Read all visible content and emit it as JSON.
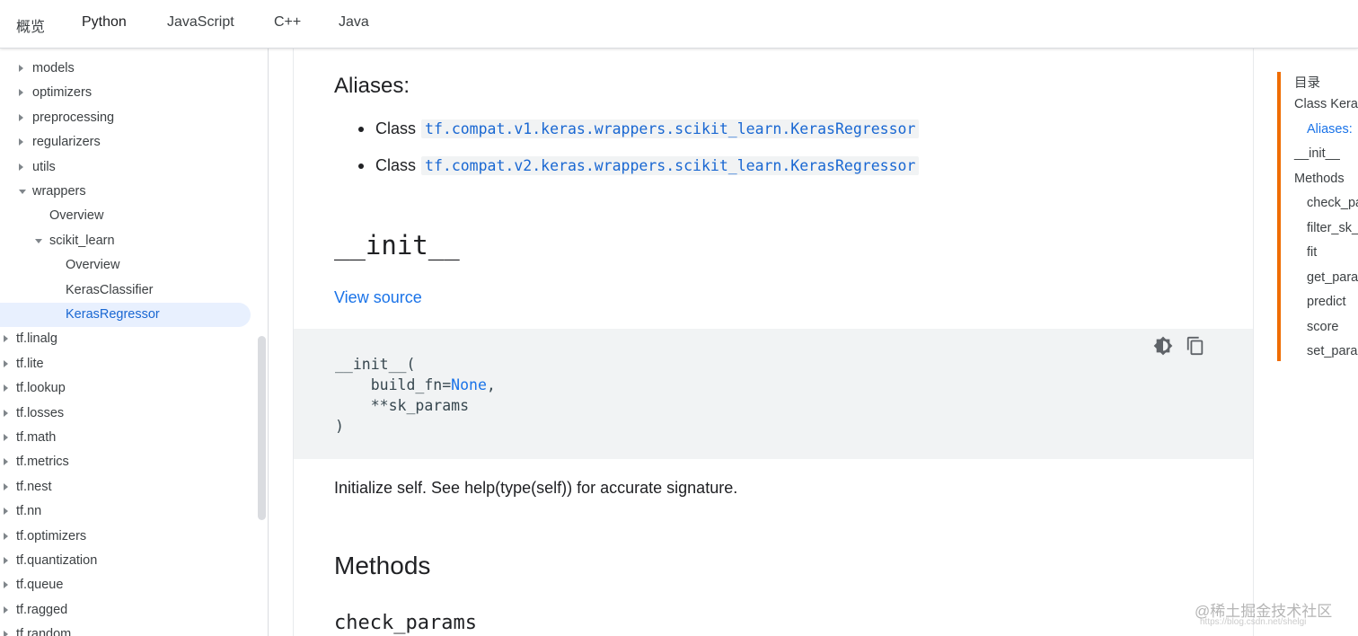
{
  "tabs": [
    "概览",
    "Python",
    "JavaScript",
    "C++",
    "Java"
  ],
  "active_tab": "Python",
  "sidebar": {
    "items": [
      {
        "label": "models",
        "level": 1,
        "caret": "right"
      },
      {
        "label": "optimizers",
        "level": 1,
        "caret": "right"
      },
      {
        "label": "preprocessing",
        "level": 1,
        "caret": "right"
      },
      {
        "label": "regularizers",
        "level": 1,
        "caret": "right"
      },
      {
        "label": "utils",
        "level": 1,
        "caret": "right"
      },
      {
        "label": "wrappers",
        "level": 1,
        "caret": "down"
      },
      {
        "label": "Overview",
        "level": 2,
        "caret": "none"
      },
      {
        "label": "scikit_learn",
        "level": 2,
        "caret": "down"
      },
      {
        "label": "Overview",
        "level": 3,
        "caret": "none"
      },
      {
        "label": "KerasClassifier",
        "level": 3,
        "caret": "none"
      },
      {
        "label": "KerasRegressor",
        "level": 3,
        "caret": "none",
        "selected": true
      },
      {
        "label": "tf.linalg",
        "level": 0,
        "caret": "right"
      },
      {
        "label": "tf.lite",
        "level": 0,
        "caret": "right"
      },
      {
        "label": "tf.lookup",
        "level": 0,
        "caret": "right"
      },
      {
        "label": "tf.losses",
        "level": 0,
        "caret": "right"
      },
      {
        "label": "tf.math",
        "level": 0,
        "caret": "right"
      },
      {
        "label": "tf.metrics",
        "level": 0,
        "caret": "right"
      },
      {
        "label": "tf.nest",
        "level": 0,
        "caret": "right"
      },
      {
        "label": "tf.nn",
        "level": 0,
        "caret": "right"
      },
      {
        "label": "tf.optimizers",
        "level": 0,
        "caret": "right"
      },
      {
        "label": "tf.quantization",
        "level": 0,
        "caret": "right"
      },
      {
        "label": "tf.queue",
        "level": 0,
        "caret": "right"
      },
      {
        "label": "tf.ragged",
        "level": 0,
        "caret": "right"
      },
      {
        "label": "tf.random",
        "level": 0,
        "caret": "right"
      }
    ]
  },
  "main": {
    "aliases_heading": "Aliases:",
    "aliases": [
      {
        "prefix": "Class",
        "code": "tf.compat.v1.keras.wrappers.scikit_learn.KerasRegressor"
      },
      {
        "prefix": "Class",
        "code": "tf.compat.v2.keras.wrappers.scikit_learn.KerasRegressor"
      }
    ],
    "init_heading": "__init__",
    "view_source": "View source",
    "code": {
      "line1": "__init__(",
      "line2_a": "    build_fn=",
      "line2_none": "None",
      "line2_b": ",",
      "line3": "    **sk_params",
      "line4": ")"
    },
    "init_description": "Initialize self. See help(type(self)) for accurate signature.",
    "methods_heading": "Methods",
    "check_params_heading": "check_params"
  },
  "toc": {
    "title": "目录",
    "items": [
      {
        "label": "Class Kera",
        "level": 0
      },
      {
        "label": "Aliases:",
        "level": 1,
        "active": true
      },
      {
        "label": "__init__",
        "level": 0
      },
      {
        "label": "Methods",
        "level": 0
      },
      {
        "label": "check_pa",
        "level": 1
      },
      {
        "label": "filter_sk_",
        "level": 1
      },
      {
        "label": "fit",
        "level": 1
      },
      {
        "label": "get_para",
        "level": 1
      },
      {
        "label": "predict",
        "level": 1
      },
      {
        "label": "score",
        "level": 1
      },
      {
        "label": "set_para",
        "level": 1
      }
    ]
  },
  "watermark": {
    "text": "@稀土掘金技术社区",
    "url": "https://blog.csdn.net/shelgi"
  },
  "colors": {
    "link": "#1a73e8",
    "toc_accent": "#ef6c00",
    "selected_bg": "#e8f0fe",
    "code_bg": "#f1f3f4"
  }
}
